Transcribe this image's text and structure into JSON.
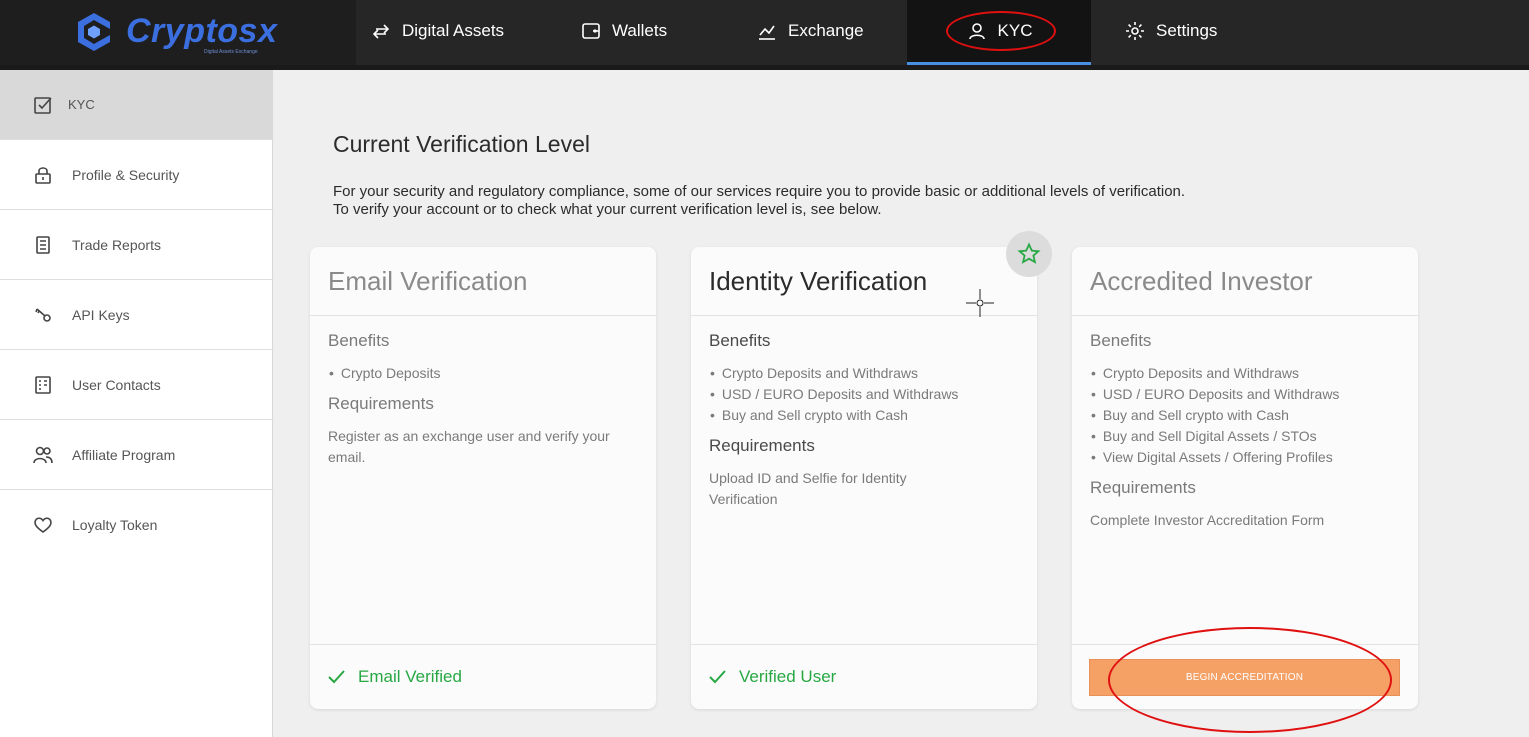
{
  "brand": {
    "name": "Cryptosx",
    "tagline": "Digital Assets Exchange",
    "accent": "#3b6fe0"
  },
  "nav": {
    "items": [
      {
        "label": "Digital Assets",
        "icon": "swap-arrows-icon"
      },
      {
        "label": "Wallets",
        "icon": "wallet-icon"
      },
      {
        "label": "Exchange",
        "icon": "chart-line-icon"
      },
      {
        "label": "KYC",
        "icon": "user-icon",
        "active": true
      },
      {
        "label": "Settings",
        "icon": "gear-icon"
      }
    ]
  },
  "sidebar": {
    "items": [
      {
        "label": "KYC",
        "icon": "checkbox-icon",
        "active": true
      },
      {
        "label": "Profile & Security",
        "icon": "lock-icon"
      },
      {
        "label": "Trade Reports",
        "icon": "report-icon"
      },
      {
        "label": "API Keys",
        "icon": "key-icon"
      },
      {
        "label": "User Contacts",
        "icon": "contacts-icon"
      },
      {
        "label": "Affiliate Program",
        "icon": "users-icon"
      },
      {
        "label": "Loyalty Token",
        "icon": "heart-icon"
      }
    ]
  },
  "main": {
    "title": "Current Verification Level",
    "intro_line1": "For your security and regulatory compliance, some of our services require you to provide basic or additional levels of verification.",
    "intro_line2": "To verify your account or to check what your current verification level is, see below."
  },
  "cards": [
    {
      "title": "Email Verification",
      "benefits_label": "Benefits",
      "benefits": [
        "Crypto Deposits"
      ],
      "requirements_label": "Requirements",
      "requirements": "Register as an exchange user and verify your email.",
      "status": "Email Verified"
    },
    {
      "title": "Identity Verification",
      "benefits_label": "Benefits",
      "benefits": [
        "Crypto Deposits and Withdraws",
        "USD / EURO Deposits and Withdraws",
        "Buy and Sell crypto with Cash"
      ],
      "requirements_label": "Requirements",
      "requirements": "Upload ID and Selfie for Identity Verification",
      "status": "Verified User",
      "current": true
    },
    {
      "title": "Accredited Investor",
      "benefits_label": "Benefits",
      "benefits": [
        "Crypto Deposits and Withdraws",
        "USD / EURO Deposits and Withdraws",
        "Buy and Sell crypto with Cash",
        "Buy and Sell Digital Assets / STOs",
        "View Digital Assets / Offering Profiles"
      ],
      "requirements_label": "Requirements",
      "requirements": "Complete Investor Accreditation Form",
      "action": "BEGIN ACCREDITATION"
    }
  ],
  "colors": {
    "success": "#27a844",
    "action": "#f5a166",
    "highlight": "#e01010",
    "nav_underline": "#4a90e2"
  }
}
